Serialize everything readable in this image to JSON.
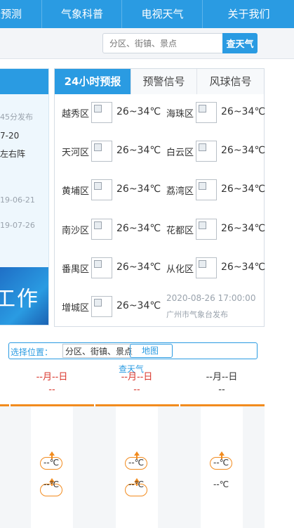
{
  "nav": {
    "items": [
      "天预测",
      "气象科普",
      "电视天气",
      "关于我们"
    ]
  },
  "search": {
    "placeholder": "分区、街镇、景点",
    "button": "查天气"
  },
  "left_panel": {
    "line1": "45分发布",
    "line2": "7-20",
    "line3": "左右阵",
    "date1": "19-06-21",
    "date2": "19-07-26",
    "banner": "工作"
  },
  "forecast": {
    "tabs": [
      "24小时预报",
      "预警信号",
      "风球信号"
    ],
    "active_tab": 0,
    "districts": [
      {
        "name": "越秀区",
        "temp": "26~34℃"
      },
      {
        "name": "海珠区",
        "temp": "26~34℃"
      },
      {
        "name": "天河区",
        "temp": "26~34℃"
      },
      {
        "name": "白云区",
        "temp": "26~34℃"
      },
      {
        "name": "黄埔区",
        "temp": "26~34℃"
      },
      {
        "name": "荔湾区",
        "temp": "26~34℃"
      },
      {
        "name": "南沙区",
        "temp": "26~34℃"
      },
      {
        "name": "花都区",
        "temp": "26~34℃"
      },
      {
        "name": "番禺区",
        "temp": "26~34℃"
      },
      {
        "name": "从化区",
        "temp": "26~34℃"
      },
      {
        "name": "增城区",
        "temp": "26~34℃"
      }
    ],
    "publish_time": "2020-08-26 17:00:00",
    "publisher": "广州市气象台发布"
  },
  "location": {
    "label": "选择位置：",
    "input_value": "分区、街镇、景点",
    "map_button": "地图",
    "query_button": "查天气"
  },
  "days": [
    {
      "date": "--月--日",
      "sub": "--",
      "color": "#d9352b"
    },
    {
      "date": "--月--日",
      "sub": "--",
      "color": "#d9352b"
    },
    {
      "date": "--月--日",
      "sub": "--",
      "color": "#333333"
    }
  ],
  "temps": {
    "high": "--℃",
    "low": "--℃"
  },
  "colors": {
    "primary": "#2a9be2",
    "accent": "#f28b1e",
    "alert": "#d9352b"
  }
}
